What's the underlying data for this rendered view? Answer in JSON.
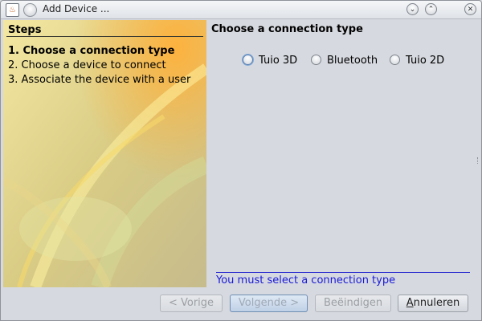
{
  "window": {
    "title": "Add Device ...",
    "app_icon": "java-icon",
    "menu_icon": "window-menu-icon",
    "minimize_icon": "chevron-down-icon",
    "maximize_icon": "chevron-up-icon",
    "close_icon": "close-icon",
    "minimize_glyph": "⌄",
    "maximize_glyph": "⌃",
    "close_glyph": "✕",
    "app_icon_glyph": "♨"
  },
  "steps": {
    "title": "Steps",
    "items": [
      {
        "label": "1. Choose a connection type",
        "active": true
      },
      {
        "label": "2. Choose a device to connect",
        "active": false
      },
      {
        "label": "3. Associate the device with a user",
        "active": false
      }
    ]
  },
  "content": {
    "title": "Choose a connection type",
    "options": [
      {
        "label": "Tuio 3D",
        "selected": false,
        "focused": true
      },
      {
        "label": "Bluetooth",
        "selected": false,
        "focused": false
      },
      {
        "label": "Tuio 2D",
        "selected": false,
        "focused": false
      }
    ],
    "message": "You must select a connection type"
  },
  "buttons": {
    "previous": {
      "label": "< Vorige",
      "enabled": false
    },
    "next": {
      "label": "Volgende >",
      "enabled": false
    },
    "finish": {
      "label": "Beëindigen",
      "enabled": false
    },
    "cancel": {
      "prefix": "",
      "mnemonic": "A",
      "rest": "nnuleren",
      "label": "Annuleren",
      "enabled": true
    }
  },
  "colors": {
    "accent": "#1a1ad8",
    "steps_panel": "#cbc28a",
    "window_bg": "#d6d9df"
  }
}
